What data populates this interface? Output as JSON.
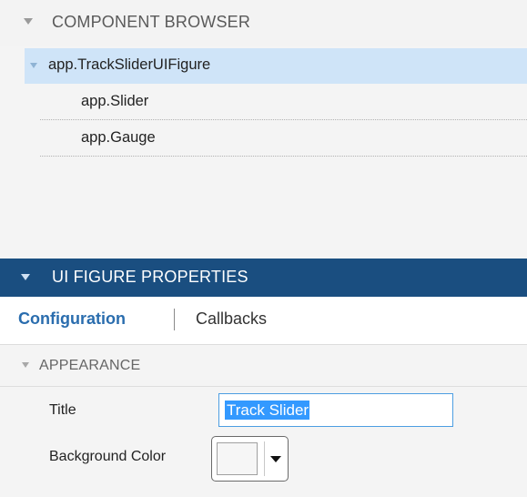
{
  "component_browser": {
    "title": "COMPONENT BROWSER",
    "tree": {
      "root": "app.TrackSliderUIFigure",
      "children": [
        "app.Slider",
        "app.Gauge"
      ]
    }
  },
  "properties": {
    "title": "UI FIGURE PROPERTIES",
    "tabs": [
      {
        "label": "Configuration",
        "active": true
      },
      {
        "label": "Callbacks",
        "active": false
      }
    ],
    "section": {
      "title": "APPEARANCE"
    },
    "fields": {
      "title_label": "Title",
      "title_value": "Track Slider",
      "background_label": "Background Color",
      "background_value": "#f6f6f6"
    }
  },
  "colors": {
    "panel_header_bg": "#1a4e80",
    "selection_bg": "#cfe4f8",
    "accent": "#2a6dae",
    "text_highlight": "#3399ff"
  }
}
